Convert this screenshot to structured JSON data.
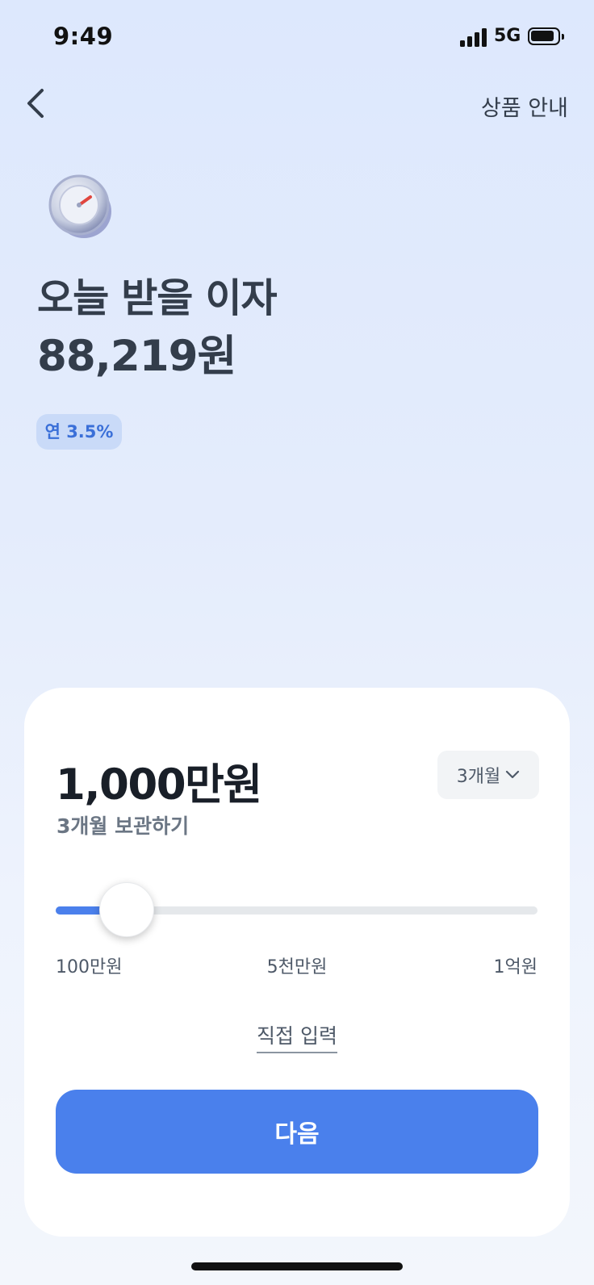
{
  "status_bar": {
    "time": "9:49",
    "network": "5G"
  },
  "header": {
    "product_info_label": "상품 안내"
  },
  "hero": {
    "headline": "오늘 받을 이자",
    "amount": "88,219원",
    "rate_badge": "연 3.5%"
  },
  "deposit": {
    "amount": "1,000만원",
    "period_selected": "3개월",
    "keep_label": "3개월 보관하기",
    "slider": {
      "fraction": 0.09,
      "min_label": "100만원",
      "mid_label": "5천만원",
      "max_label": "1억원"
    },
    "direct_input_label": "직접 입력",
    "next_button_label": "다음"
  },
  "colors": {
    "accent": "#4a80ec",
    "badge_bg": "#c9daf8",
    "badge_text": "#3a6fd8"
  }
}
